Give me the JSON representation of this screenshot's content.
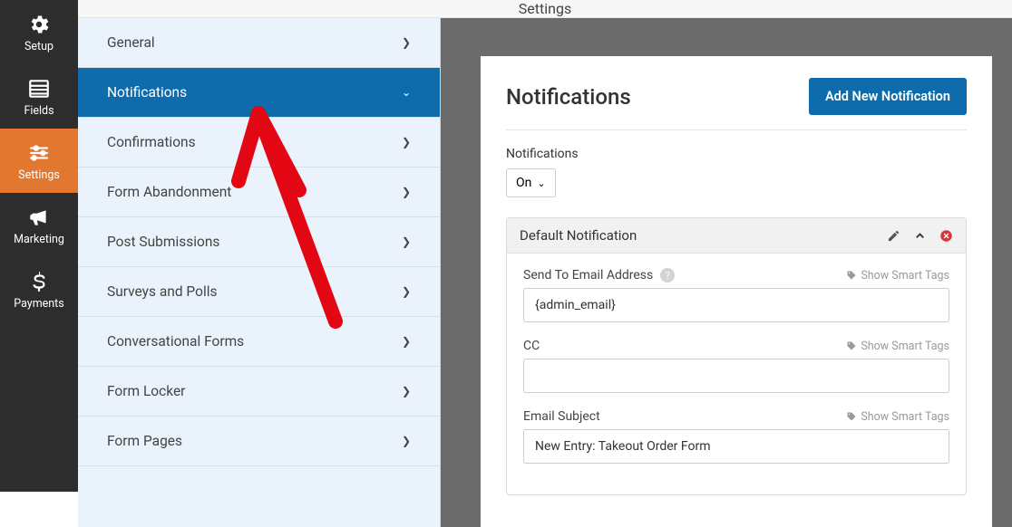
{
  "header": {
    "title": "Settings"
  },
  "leftbar": {
    "items": [
      {
        "label": "Setup"
      },
      {
        "label": "Fields"
      },
      {
        "label": "Settings"
      },
      {
        "label": "Marketing"
      },
      {
        "label": "Payments"
      }
    ]
  },
  "submenu": {
    "items": [
      {
        "label": "General"
      },
      {
        "label": "Notifications"
      },
      {
        "label": "Confirmations"
      },
      {
        "label": "Form Abandonment"
      },
      {
        "label": "Post Submissions"
      },
      {
        "label": "Surveys and Polls"
      },
      {
        "label": "Conversational Forms"
      },
      {
        "label": "Form Locker"
      },
      {
        "label": "Form Pages"
      }
    ]
  },
  "panel": {
    "title": "Notifications",
    "add_button": "Add New Notification",
    "toggle_label": "Notifications",
    "toggle_value": "On",
    "card_title": "Default Notification",
    "smart_tags": "Show Smart Tags",
    "fields": {
      "send_to": {
        "label": "Send To Email Address",
        "value": "{admin_email}"
      },
      "cc": {
        "label": "CC",
        "value": ""
      },
      "subject": {
        "label": "Email Subject",
        "value": "New Entry: Takeout Order Form"
      }
    }
  }
}
